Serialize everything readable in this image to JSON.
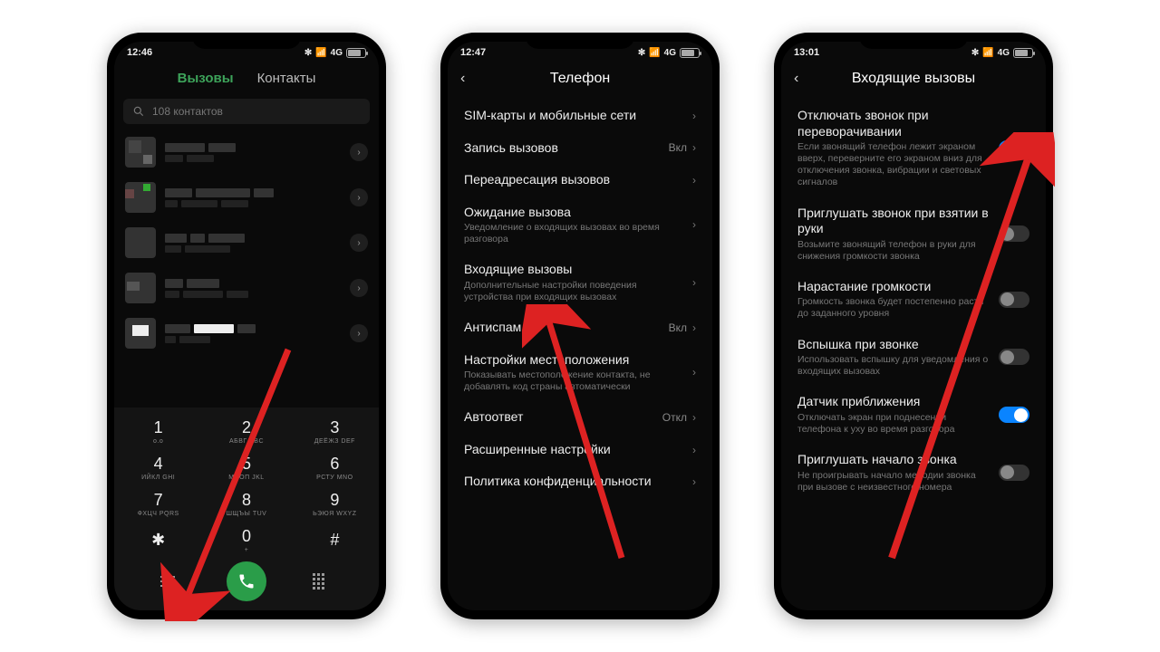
{
  "phone1": {
    "time": "12:46",
    "network": "4G",
    "tabs": {
      "calls": "Вызовы",
      "contacts": "Контакты"
    },
    "search_placeholder": "108 контактов",
    "keypad": [
      {
        "n": "1",
        "l": "о.о"
      },
      {
        "n": "2",
        "l": "АБВГ\nABC"
      },
      {
        "n": "3",
        "l": "ДЕЁЖЗ\nDEF"
      },
      {
        "n": "4",
        "l": "ИЙКЛ\nGHI"
      },
      {
        "n": "5",
        "l": "МНОП\nJKL"
      },
      {
        "n": "6",
        "l": "РСТУ\nMNO"
      },
      {
        "n": "7",
        "l": "ФХЦЧ\nPQRS"
      },
      {
        "n": "8",
        "l": "ШЩЪЫ\nTUV"
      },
      {
        "n": "9",
        "l": "ЬЭЮЯ\nWXYZ"
      },
      {
        "n": "✱",
        "l": ""
      },
      {
        "n": "0",
        "l": "+"
      },
      {
        "n": "#",
        "l": ""
      }
    ]
  },
  "phone2": {
    "time": "12:47",
    "network": "4G",
    "title": "Телефон",
    "items": [
      {
        "title": "SIM-карты и мобильные сети",
        "sub": "",
        "val": ""
      },
      {
        "title": "Запись вызовов",
        "sub": "",
        "val": "Вкл"
      },
      {
        "title": "Переадресация вызовов",
        "sub": "",
        "val": ""
      },
      {
        "title": "Ожидание вызова",
        "sub": "Уведомление о входящих вызовах во время разговора",
        "val": ""
      },
      {
        "title": "Входящие вызовы",
        "sub": "Дополнительные настройки поведения устройства при входящих вызовах",
        "val": ""
      },
      {
        "title": "Антиспам",
        "sub": "",
        "val": "Вкл"
      },
      {
        "title": "Настройки местоположения",
        "sub": "Показывать местоположение контакта, не добавлять код страны автоматически",
        "val": ""
      },
      {
        "title": "Автоответ",
        "sub": "",
        "val": "Откл"
      },
      {
        "title": "Расширенные настройки",
        "sub": "",
        "val": ""
      },
      {
        "title": "Политика конфиденциальности",
        "sub": "",
        "val": ""
      }
    ]
  },
  "phone3": {
    "time": "13:01",
    "network": "4G",
    "title": "Входящие вызовы",
    "items": [
      {
        "title": "Отключать звонок при переворачивании",
        "sub": "Если звонящий телефон лежит экраном вверх, переверните его экраном вниз для отключения звонка, вибрации и световых сигналов",
        "on": true
      },
      {
        "title": "Приглушать звонок при взятии в руки",
        "sub": "Возьмите звонящий телефон в руки для снижения громкости звонка",
        "on": false
      },
      {
        "title": "Нарастание громкости",
        "sub": "Громкость звонка будет постепенно расти до заданного уровня",
        "on": false
      },
      {
        "title": "Вспышка при звонке",
        "sub": "Использовать вспышку для уведомления о входящих вызовах",
        "on": false
      },
      {
        "title": "Датчик приближения",
        "sub": "Отключать экран при поднесении телефона к уху во время разговора",
        "on": true
      },
      {
        "title": "Приглушать начало звонка",
        "sub": "Не проигрывать начало мелодии звонка при вызове с неизвестного номера",
        "on": false
      }
    ]
  }
}
